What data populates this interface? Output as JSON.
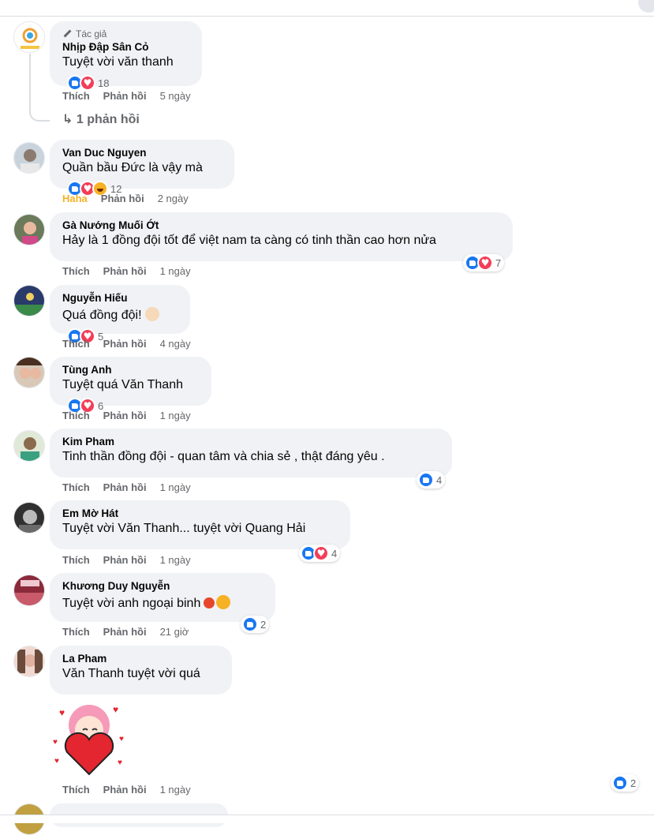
{
  "comments": [
    {
      "badge_label": "Tác giả",
      "author": "Nhịp Đập Sân Cỏ",
      "text": "Tuyệt vời văn thanh",
      "reactions": "18",
      "actions": {
        "like": "Thích",
        "reply": "Phản hồi",
        "time": "5 ngày"
      },
      "replies_link": "1 phản hồi"
    },
    {
      "author": "Van Duc Nguyen",
      "text": "Quần bầu Đức là vậy mà",
      "reactions": "12",
      "actions": {
        "like": "Haha",
        "reply": "Phản hồi",
        "time": "2 ngày"
      }
    },
    {
      "author": "Gà Nướng Muối Ớt",
      "text": "Hảy là 1 đồng đội tốt để việt nam ta càng có tinh thần cao hơn nửa",
      "reactions": "7",
      "actions": {
        "like": "Thích",
        "reply": "Phản hồi",
        "time": "1 ngày"
      }
    },
    {
      "author": "Nguyễn Hiếu",
      "text": "Quá đồng đội!",
      "reactions": "5",
      "actions": {
        "like": "Thích",
        "reply": "Phản hồi",
        "time": "4 ngày"
      }
    },
    {
      "author": "Tùng Anh",
      "text": "Tuyệt quá Văn Thanh",
      "reactions": "6",
      "actions": {
        "like": "Thích",
        "reply": "Phản hồi",
        "time": "1 ngày"
      }
    },
    {
      "author": "Kim Pham",
      "text": "Tinh thần đồng đội - quan tâm và chia sẻ , thật đáng yêu .",
      "reactions": "4",
      "actions": {
        "like": "Thích",
        "reply": "Phản hồi",
        "time": "1 ngày"
      }
    },
    {
      "author": "Em Mờ Hát",
      "text": "Tuyệt vời Văn Thanh... tuyệt vời Quang Hải",
      "reactions": "4",
      "actions": {
        "like": "Thích",
        "reply": "Phản hồi",
        "time": "1 ngày"
      }
    },
    {
      "author": "Khương Duy Nguyễn",
      "text": "Tuyệt vời anh ngoại binh",
      "reactions": "2",
      "actions": {
        "like": "Thích",
        "reply": "Phản hồi",
        "time": "21 giờ"
      }
    },
    {
      "author": "La Pham",
      "text": "Văn Thanh tuyệt vời quá",
      "reactions": "2",
      "actions": {
        "like": "Thích",
        "reply": "Phản hồi",
        "time": "1 ngày"
      }
    }
  ],
  "colors": {
    "like": "#1877f2",
    "love": "#f33e58",
    "haha": "#f7b125",
    "bubble": "#f0f2f5",
    "meta": "#65676b"
  }
}
